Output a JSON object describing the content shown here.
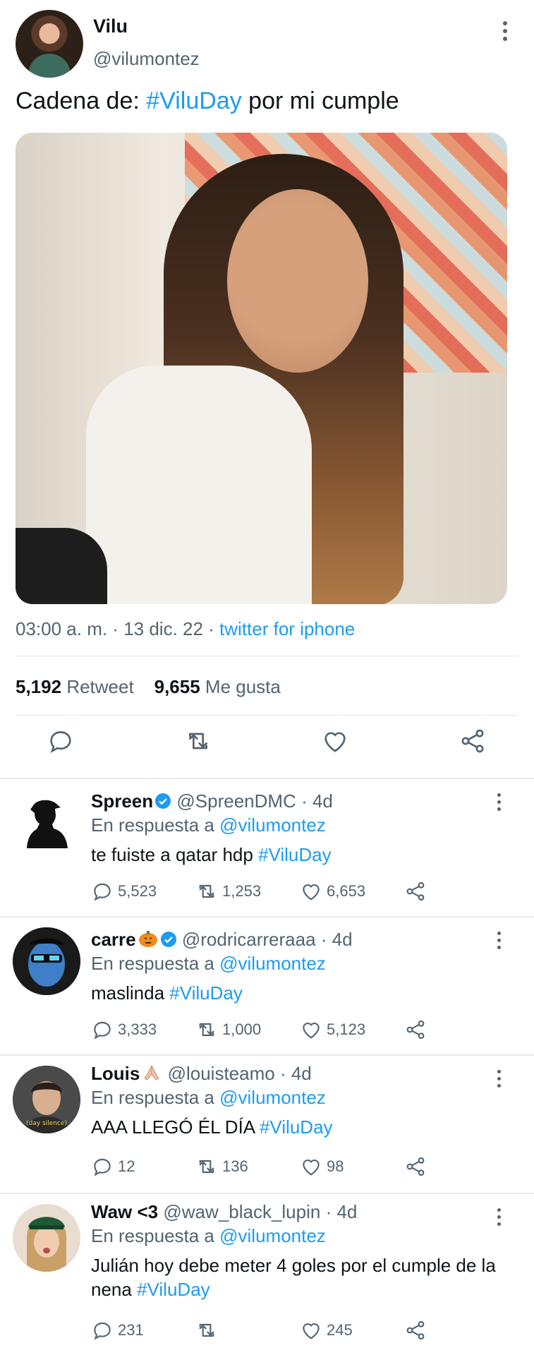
{
  "main_tweet": {
    "author_name": "Vilu",
    "author_handle": "@vilumontez",
    "text_prefix": "Cadena de: ",
    "hashtag": "#ViluDay",
    "text_suffix": " por mi cumple",
    "time": "03:00 a. m.",
    "date": "13 dic. 22",
    "source": "twitter for iphone",
    "retweets_count": "5,192",
    "retweets_label": "Retweet",
    "likes_count": "9,655",
    "likes_label": "Me gusta"
  },
  "replies": [
    {
      "name": "Spreen",
      "verified": true,
      "emoji": "",
      "handle": "@SpreenDMC",
      "age": "4d",
      "reply_prefix": "En respuesta a ",
      "reply_to": "@vilumontez",
      "text": "te fuiste a qatar hdp ",
      "hashtag": "#ViluDay",
      "replies": "5,523",
      "retweets": "1,253",
      "likes": "6,653"
    },
    {
      "name": "carre",
      "verified": true,
      "emoji": "pumpkin-emoji",
      "handle": "@rodricarreraaa",
      "age": "4d",
      "reply_prefix": "En respuesta a ",
      "reply_to": "@vilumontez",
      "text": "maslinda ",
      "hashtag": "#ViluDay",
      "replies": "3,333",
      "retweets": "1,000",
      "likes": "5,123"
    },
    {
      "name": "Louis",
      "verified": false,
      "emoji": "praying-hands-emoji",
      "handle": "@louisteamo",
      "age": "4d",
      "reply_prefix": "En respuesta a ",
      "reply_to": "@vilumontez",
      "text": "AAA LLEGÓ ÉL DÍA ",
      "hashtag": "#ViluDay",
      "avatar_caption": "(day silence)",
      "replies": "12",
      "retweets": "136",
      "likes": "98"
    },
    {
      "name": "Waw <3",
      "verified": false,
      "emoji": "",
      "handle": "@waw_black_lupin",
      "age": "4d",
      "reply_prefix": "En respuesta a ",
      "reply_to": "@vilumontez",
      "text": "Julián hoy debe meter 4 goles por el cumple de la nena ",
      "hashtag": "#ViluDay",
      "replies": "231",
      "retweets": "",
      "likes": "245"
    }
  ],
  "colors": {
    "accent": "#1d9bf0",
    "secondary_text": "#536471",
    "primary_text": "#0f1419"
  }
}
